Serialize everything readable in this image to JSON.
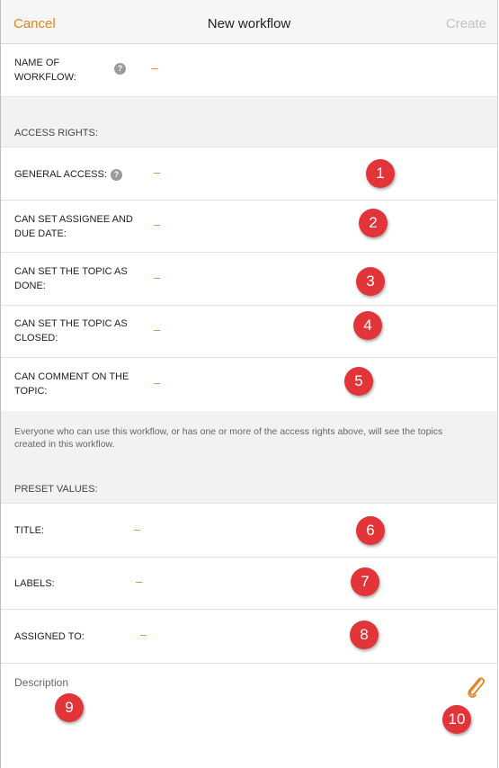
{
  "header": {
    "cancel": "Cancel",
    "title": "New workflow",
    "create": "Create"
  },
  "name_row": {
    "label_line1": "NAME OF",
    "label_line2": "WORKFLOW:",
    "help": "?",
    "value": "–"
  },
  "access_section": {
    "title": "ACCESS RIGHTS:"
  },
  "access_rows": [
    {
      "line1": "GENERAL ACCESS:",
      "line2": "",
      "value": "–",
      "help": "?"
    },
    {
      "line1": "CAN SET ASSIGNEE AND",
      "line2": "DUE DATE:",
      "value": "–"
    },
    {
      "line1": "CAN SET THE TOPIC AS",
      "line2": "DONE:",
      "value": "–"
    },
    {
      "line1": "CAN SET THE TOPIC AS",
      "line2": "CLOSED:",
      "value": "–"
    },
    {
      "line1": "CAN COMMENT ON THE",
      "line2": "TOPIC:",
      "value": "–"
    }
  ],
  "note": "Everyone who can use this workflow, or has one or more of the access rights above, will see the topics created in this workflow.",
  "preset_section": {
    "title": "PRESET VALUES:"
  },
  "preset_rows": [
    {
      "label": "TITLE:",
      "value": "–"
    },
    {
      "label": "LABELS:",
      "value": "–"
    },
    {
      "label": "ASSIGNED TO:",
      "value": "–"
    }
  ],
  "description": {
    "placeholder": "Description",
    "attach_icon": "paperclip-icon"
  },
  "badges": [
    "1",
    "2",
    "3",
    "4",
    "5",
    "6",
    "7",
    "8",
    "9",
    "10"
  ],
  "colors": {
    "accent": "#e8821e",
    "badge": "#e2353a",
    "section_bg": "#f2f2f2"
  }
}
